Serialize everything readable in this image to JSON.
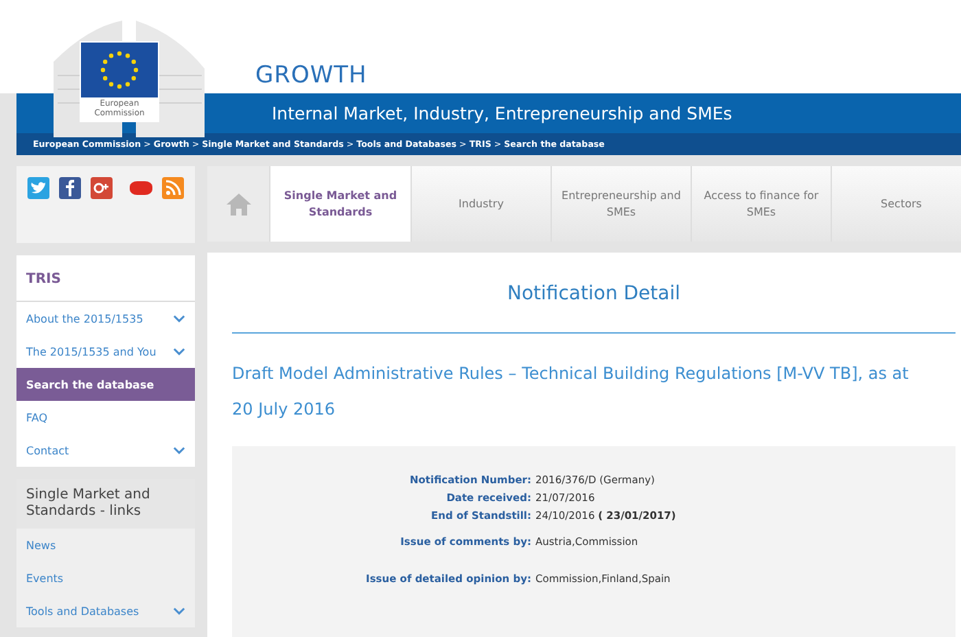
{
  "header": {
    "logo_text": "European Commission",
    "site_title": "GROWTH",
    "subtitle": "Internal Market, Industry, Entrepreneurship and SMEs"
  },
  "breadcrumb": [
    {
      "label": "European Commission",
      "separator": ">"
    },
    {
      "label": "Growth",
      "separator": ">"
    },
    {
      "label": "Single Market and Standards",
      "separator": ">"
    },
    {
      "label": "Tools and Databases",
      "separator": ">"
    },
    {
      "label": "TRIS",
      "separator": ">"
    },
    {
      "label": "Search the database"
    }
  ],
  "social_icons": [
    {
      "kind": "twitter"
    },
    {
      "kind": "facebook"
    },
    {
      "kind": "googleplus"
    },
    {
      "kind": "youtube"
    },
    {
      "kind": "rss"
    }
  ],
  "tabs": [
    {
      "label": "Single Market and Standards",
      "selected": true
    },
    {
      "label": "Industry",
      "selected": false
    },
    {
      "label": "Entrepreneurship and SMEs",
      "selected": false
    },
    {
      "label": "Access to finance for SMEs",
      "selected": false
    },
    {
      "label": "Sectors",
      "selected": false
    }
  ],
  "sidebar": {
    "title": "TRIS",
    "items": [
      {
        "label": "About the 2015/1535",
        "expandable": true,
        "selected": false
      },
      {
        "label": "The 2015/1535 and You",
        "expandable": true,
        "selected": false
      },
      {
        "label": "Search the database",
        "expandable": false,
        "selected": true
      },
      {
        "label": "FAQ",
        "expandable": false,
        "selected": false
      },
      {
        "label": "Contact",
        "expandable": true,
        "selected": false
      }
    ]
  },
  "links_panel": {
    "title": "Single Market and Standards - links",
    "items": [
      {
        "label": "News",
        "expandable": false
      },
      {
        "label": "Events",
        "expandable": false
      },
      {
        "label": "Tools and Databases",
        "expandable": true
      }
    ]
  },
  "page_title": "Notification Detail",
  "notification_title": "Draft Model Administrative Rules – Technical Building Regulations [M-VV TB], as at 20 July 2016",
  "details": [
    {
      "label": "Notification Number:",
      "value": "2016/376/D (Germany)"
    },
    {
      "label": "Date received:",
      "value": "21/07/2016"
    },
    {
      "label": "End of Standstill:",
      "value": "24/10/2016 **( 23/01/2017)**"
    },
    {
      "label": "Issue of comments by:",
      "value": "Austria,Commission"
    },
    {
      "label": "Issue of detailed opinion by:",
      "value": "Commission,Finland,Spain"
    }
  ]
}
